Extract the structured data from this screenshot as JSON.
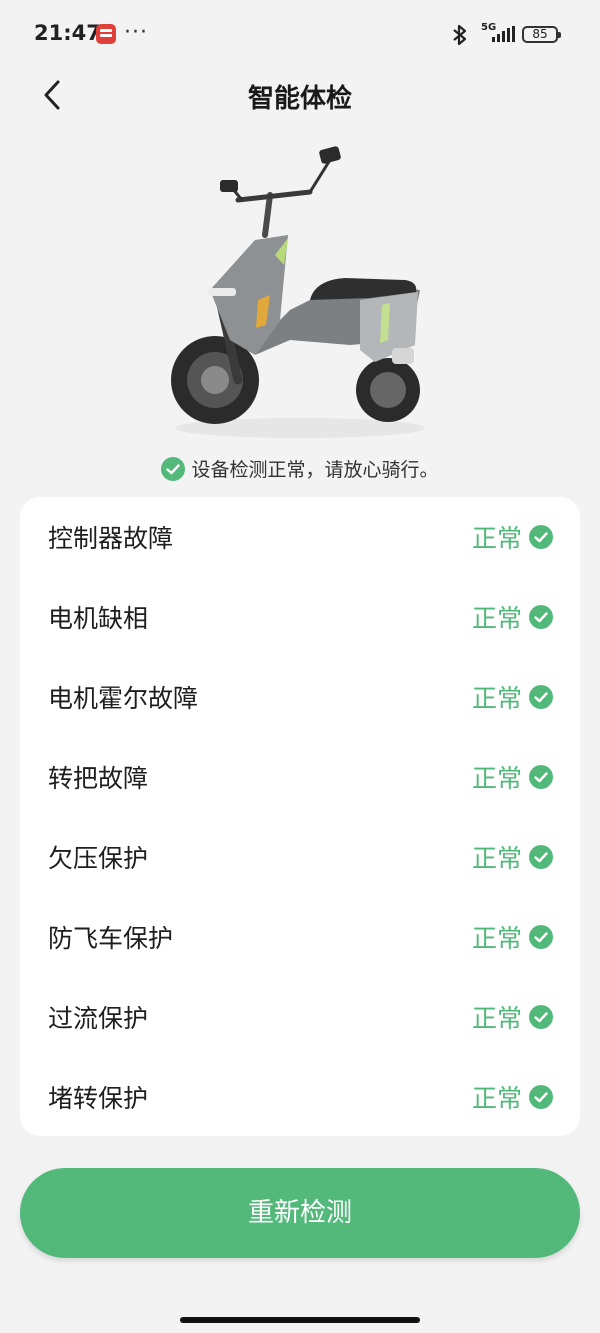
{
  "status_bar": {
    "time": "21:47",
    "app_icon": "notification-app-icon",
    "more": "···",
    "network": "5G",
    "battery": "85"
  },
  "header": {
    "title": "智能体检",
    "back_icon": "chevron-left-icon"
  },
  "device_image": "electric-scooter",
  "check_message": "设备检测正常，请放心骑行。",
  "checks": [
    {
      "label": "控制器故障",
      "status": "正常"
    },
    {
      "label": "电机缺相",
      "status": "正常"
    },
    {
      "label": "电机霍尔故障",
      "status": "正常"
    },
    {
      "label": "转把故障",
      "status": "正常"
    },
    {
      "label": "欠压保护",
      "status": "正常"
    },
    {
      "label": "防飞车保护",
      "status": "正常"
    },
    {
      "label": "过流保护",
      "status": "正常"
    },
    {
      "label": "堵转保护",
      "status": "正常"
    }
  ],
  "retest_button": "重新检测",
  "colors": {
    "accent": "#53b97b",
    "background": "#f3f3f3",
    "card": "#ffffff"
  }
}
